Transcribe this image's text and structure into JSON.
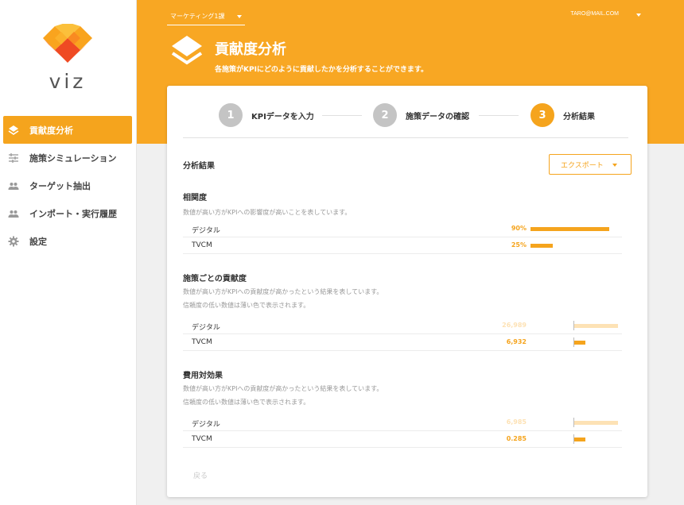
{
  "app": {
    "logo_text": "viz"
  },
  "sidebar": {
    "items": [
      {
        "label": "貢献度分析",
        "icon": "layers-icon",
        "active": true
      },
      {
        "label": "施策シミュレーション",
        "icon": "sliders-icon",
        "active": false
      },
      {
        "label": "ターゲット抽出",
        "icon": "people-icon",
        "active": false
      },
      {
        "label": "インポート・実行履歴",
        "icon": "people-icon",
        "active": false
      },
      {
        "label": "設定",
        "icon": "gear-icon",
        "active": false
      }
    ]
  },
  "header": {
    "department": "マーケティング1課",
    "user_email": "TARO@MAIL.COM",
    "title": "貢献度分析",
    "subtitle": "各施策がKPIにどのように貢献したかを分析することができます。"
  },
  "stepper": {
    "steps": [
      {
        "number": "1",
        "label": "KPIデータを入力"
      },
      {
        "number": "2",
        "label": "施策データの確認"
      },
      {
        "number": "3",
        "label": "分析結果"
      }
    ]
  },
  "results": {
    "title": "分析結果",
    "export_label": "エクスポート",
    "sections": [
      {
        "title": "相関度",
        "desc": [
          "数値が高い方がKPIへの影響度が高いことを表しています。"
        ],
        "rows": [
          {
            "label": "デジタル",
            "value": "90%",
            "level": 0.9,
            "faded": false
          },
          {
            "label": "TVCM",
            "value": "25%",
            "level": 0.25,
            "faded": false
          }
        ]
      },
      {
        "title": "施策ごとの貢献度",
        "desc": [
          "数値が高い方がKPIへの貢献度が高かったという結果を表しています。",
          "信頼度の低い数値は薄い色で表示されます。"
        ],
        "rows": [
          {
            "label": "デジタル",
            "value": "26,989",
            "level": 1.0,
            "faded": true
          },
          {
            "label": "TVCM",
            "value": "6,932",
            "level": 0.26,
            "faded": false
          }
        ]
      },
      {
        "title": "費用対効果",
        "desc": [
          "数値が高い方がKPIへの貢献度が高かったという結果を表しています。",
          "信頼度の低い数値は薄い色で表示されます。"
        ],
        "rows": [
          {
            "label": "デジタル",
            "value": "6,985",
            "level": 1.0,
            "faded": true
          },
          {
            "label": "TVCM",
            "value": "0.285",
            "level": 0.26,
            "faded": false
          }
        ]
      }
    ],
    "back_label": "戻る"
  },
  "colors": {
    "accent": "#f8a723",
    "accent_light": "#fde2b5"
  }
}
